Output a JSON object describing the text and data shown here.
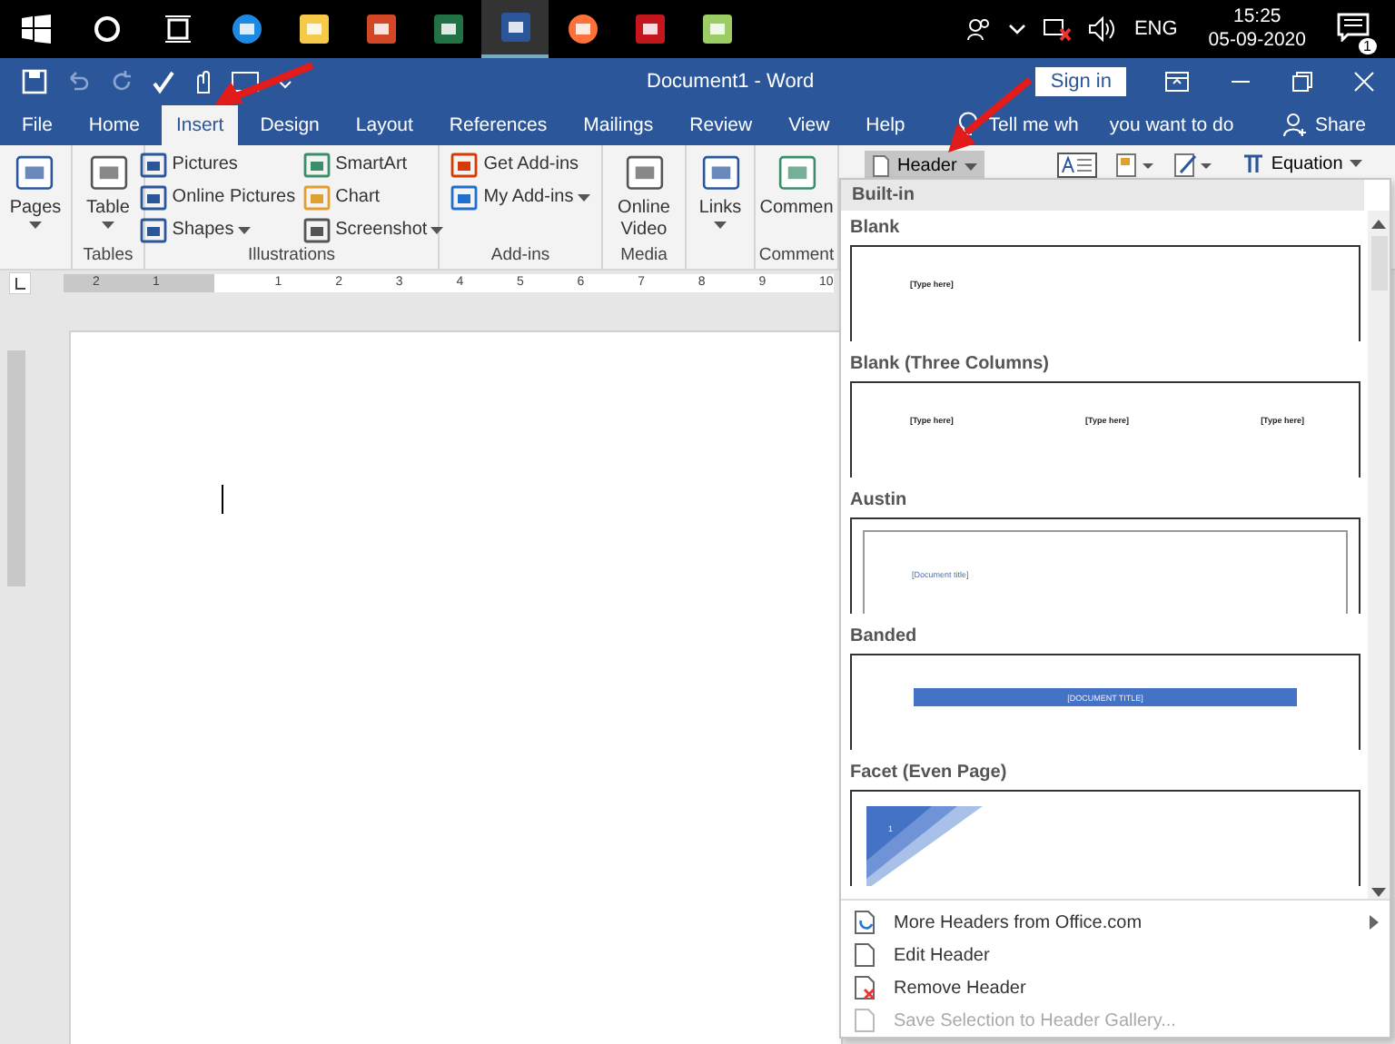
{
  "taskbar": {
    "apps": [
      {
        "selected": false
      },
      {
        "selected": false
      },
      {
        "selected": false
      },
      {
        "selected": false
      },
      {
        "selected": true
      },
      {
        "selected": false
      },
      {
        "selected": false
      },
      {
        "selected": false
      }
    ],
    "language": "ENG",
    "time": "15:25",
    "date": "05-09-2020",
    "notifications": "1"
  },
  "title_bar": {
    "title": "Document1  -  Word",
    "sign_in": "Sign in"
  },
  "tabs": [
    {
      "label": "File",
      "selected": false
    },
    {
      "label": "Home",
      "selected": false
    },
    {
      "label": "Insert",
      "selected": true
    },
    {
      "label": "Design",
      "selected": false
    },
    {
      "label": "Layout",
      "selected": false
    },
    {
      "label": "References",
      "selected": false
    },
    {
      "label": "Mailings",
      "selected": false
    },
    {
      "label": "Review",
      "selected": false
    },
    {
      "label": "View",
      "selected": false
    },
    {
      "label": "Help",
      "selected": false
    }
  ],
  "tell_me": [
    "Tell me wh",
    "you want to do"
  ],
  "share": "Share",
  "ribbon": {
    "groups": [
      {
        "items": [
          {
            "label": "Pages",
            "kind": "large",
            "dropdown": true
          }
        ]
      },
      {
        "label": "Tables",
        "items": [
          {
            "label": "Table",
            "kind": "large",
            "dropdown": true
          }
        ]
      },
      {
        "label": "Illustrations",
        "items": [
          {
            "label": "Pictures",
            "kind": "small",
            "dropdown": false
          },
          {
            "label": "Online Pictures",
            "kind": "small",
            "dropdown": false
          },
          {
            "label": "Shapes",
            "kind": "small",
            "dropdown": true
          },
          {
            "label": "SmartArt",
            "kind": "small",
            "dropdown": false
          },
          {
            "label": "Chart",
            "kind": "small",
            "dropdown": false
          },
          {
            "label": "Screenshot",
            "kind": "small",
            "dropdown": true
          }
        ]
      },
      {
        "label": "Add-ins",
        "items": [
          {
            "label": "Get Add-ins",
            "kind": "small",
            "dropdown": false
          },
          {
            "label": "My Add-ins",
            "kind": "small",
            "dropdown": true
          }
        ]
      },
      {
        "label": "Media",
        "items": [
          {
            "label": "Online Video",
            "kind": "large",
            "dropdown": false
          }
        ]
      },
      {
        "items": [
          {
            "label": "Links",
            "kind": "large",
            "dropdown": true
          }
        ]
      },
      {
        "label": "Comment",
        "items": [
          {
            "label": "Commen",
            "kind": "large",
            "dropdown": false
          }
        ]
      }
    ],
    "header_button": {
      "label": "Header",
      "selected": true
    },
    "equation": "Equation"
  },
  "ruler": {
    "labels": [
      "2",
      "1",
      "1",
      "2",
      "3",
      "4",
      "5",
      "6",
      "7",
      "8",
      "9",
      "10"
    ]
  },
  "header_menu": {
    "heading": "Built-in",
    "entries": [
      {
        "label": "Blank",
        "kind": "blank",
        "texts": [
          "[Type here]"
        ]
      },
      {
        "label": "Blank (Three Columns)",
        "kind": "three_columns",
        "texts": [
          "[Type here]",
          "[Type here]",
          "[Type here]"
        ]
      },
      {
        "label": "Austin",
        "kind": "austin",
        "texts": [
          "[Document title]"
        ]
      },
      {
        "label": "Banded",
        "kind": "banded",
        "texts": [
          "[DOCUMENT TITLE]"
        ]
      },
      {
        "label": "Facet (Even Page)",
        "kind": "facet",
        "texts": [
          "1"
        ]
      }
    ],
    "commands": [
      {
        "label": "More Headers from Office.com",
        "disabled": false,
        "submenu": true
      },
      {
        "label": "Edit Header",
        "disabled": false,
        "submenu": false
      },
      {
        "label": "Remove Header",
        "disabled": false,
        "submenu": false
      },
      {
        "label": "Save Selection to Header Gallery...",
        "disabled": true,
        "submenu": false
      }
    ]
  }
}
